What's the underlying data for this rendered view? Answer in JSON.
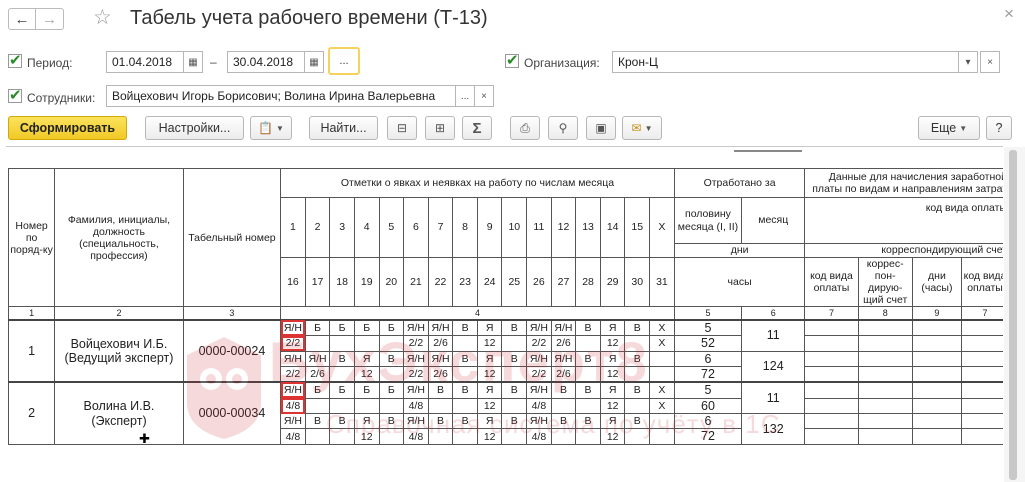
{
  "window": {
    "title": "Табель учета рабочего времени (Т-13)",
    "back_icon": "arrow-left",
    "forward_icon": "arrow-right",
    "favorite_icon": "star",
    "close_icon": "close"
  },
  "filters": {
    "period_label": "Период:",
    "date_from": "01.04.2018",
    "date_to": "30.04.2018",
    "dash": "–",
    "ellipsis": "...",
    "org_label": "Организация:",
    "org_value": "Крон-Ц",
    "employees_label": "Сотрудники:",
    "employees_value": "Войцехович Игорь Борисович; Волина Ирина Валерьевна",
    "employees_ellipsis": "...",
    "clear": "×"
  },
  "toolbar": {
    "generate": "Сформировать",
    "settings": "Настройки...",
    "find": "Найти...",
    "more": "Еще",
    "help": "?"
  },
  "watermark": {
    "text": "БухЭксперт8",
    "sub": "Справочная система по учёту в 1С"
  },
  "report": {
    "h_num": "Номер по поряд-ку",
    "h_fio": "Фамилия, инициалы, должность (специальность, профессия)",
    "h_tab": "Табельный номер",
    "h_marks": "Отметки о явках и неявках на работу по числам месяца",
    "h_worked": "Отработано за",
    "h_data": "Данные для начисления заработной платы по видам и направлениям затрат",
    "h_paycode": "код вида оплаты",
    "h_corr": "корреспондирующий счет",
    "h_half": "половину месяца (I, II)",
    "h_month": "месяц",
    "h_days": "дни",
    "h_hours": "часы",
    "h_c7": "код вида оплаты",
    "h_c8": "коррес-пон-дирую-щий счет",
    "h_c9": "дни (часы)",
    "h_c10": "код вида оплаты",
    "days1": [
      "1",
      "2",
      "3",
      "4",
      "5",
      "6",
      "7",
      "8",
      "9",
      "10",
      "11",
      "12",
      "13",
      "14",
      "15",
      "X"
    ],
    "days2": [
      "16",
      "17",
      "18",
      "19",
      "20",
      "21",
      "22",
      "23",
      "24",
      "25",
      "26",
      "27",
      "28",
      "29",
      "30",
      "31"
    ],
    "colnums": [
      "1",
      "2",
      "3",
      "4",
      "5",
      "6",
      "7",
      "8",
      "9",
      "7"
    ],
    "rows": [
      {
        "n": "1",
        "fio": "Войцехович И.Б. (Ведущий эксперт)",
        "tab": "0000-00024",
        "r1": [
          "Я/Н",
          "Б",
          "Б",
          "Б",
          "Б",
          "Я/Н",
          "Я/Н",
          "В",
          "Я",
          "В",
          "Я/Н",
          "Я/Н",
          "В",
          "Я",
          "В",
          "X"
        ],
        "r2": [
          "2/2",
          "",
          "",
          "",
          "",
          "2/2",
          "2/6",
          "",
          "12",
          "",
          "2/2",
          "2/6",
          "",
          "12",
          "",
          "X"
        ],
        "r3": [
          "Я/Н",
          "Я/Н",
          "В",
          "Я",
          "В",
          "Я/Н",
          "Я/Н",
          "В",
          "Я",
          "В",
          "Я/Н",
          "Я/Н",
          "В",
          "Я",
          "В",
          ""
        ],
        "r4": [
          "2/2",
          "2/6",
          "",
          "12",
          "",
          "2/2",
          "2/6",
          "",
          "12",
          "",
          "2/2",
          "2/6",
          "",
          "12",
          "",
          ""
        ],
        "half1_days": "5",
        "half1_hours": "52",
        "month_days": "11",
        "half2_days": "6",
        "half2_hours": "72",
        "month_hours": "124"
      },
      {
        "n": "2",
        "fio": "Волина И.В. (Эксперт)",
        "tab": "0000-00034",
        "r1": [
          "Я/Н",
          "Б",
          "Б",
          "Б",
          "Б",
          "Я/Н",
          "В",
          "В",
          "Я",
          "В",
          "Я/Н",
          "В",
          "В",
          "Я",
          "В",
          "X"
        ],
        "r2": [
          "4/8",
          "",
          "",
          "",
          "",
          "4/8",
          "",
          "",
          "12",
          "",
          "4/8",
          "",
          "",
          "12",
          "",
          "X"
        ],
        "r3": [
          "Я/Н",
          "В",
          "В",
          "Я",
          "В",
          "Я/Н",
          "В",
          "В",
          "Я",
          "В",
          "Я/Н",
          "В",
          "В",
          "Я",
          "В",
          ""
        ],
        "r4": [
          "4/8",
          "",
          "",
          "12",
          "",
          "4/8",
          "",
          "",
          "12",
          "",
          "4/8",
          "",
          "",
          "12",
          "",
          ""
        ],
        "half1_days": "5",
        "half1_hours": "60",
        "month_days": "11",
        "half2_days": "6",
        "half2_hours": "72",
        "month_hours": "132"
      }
    ]
  }
}
